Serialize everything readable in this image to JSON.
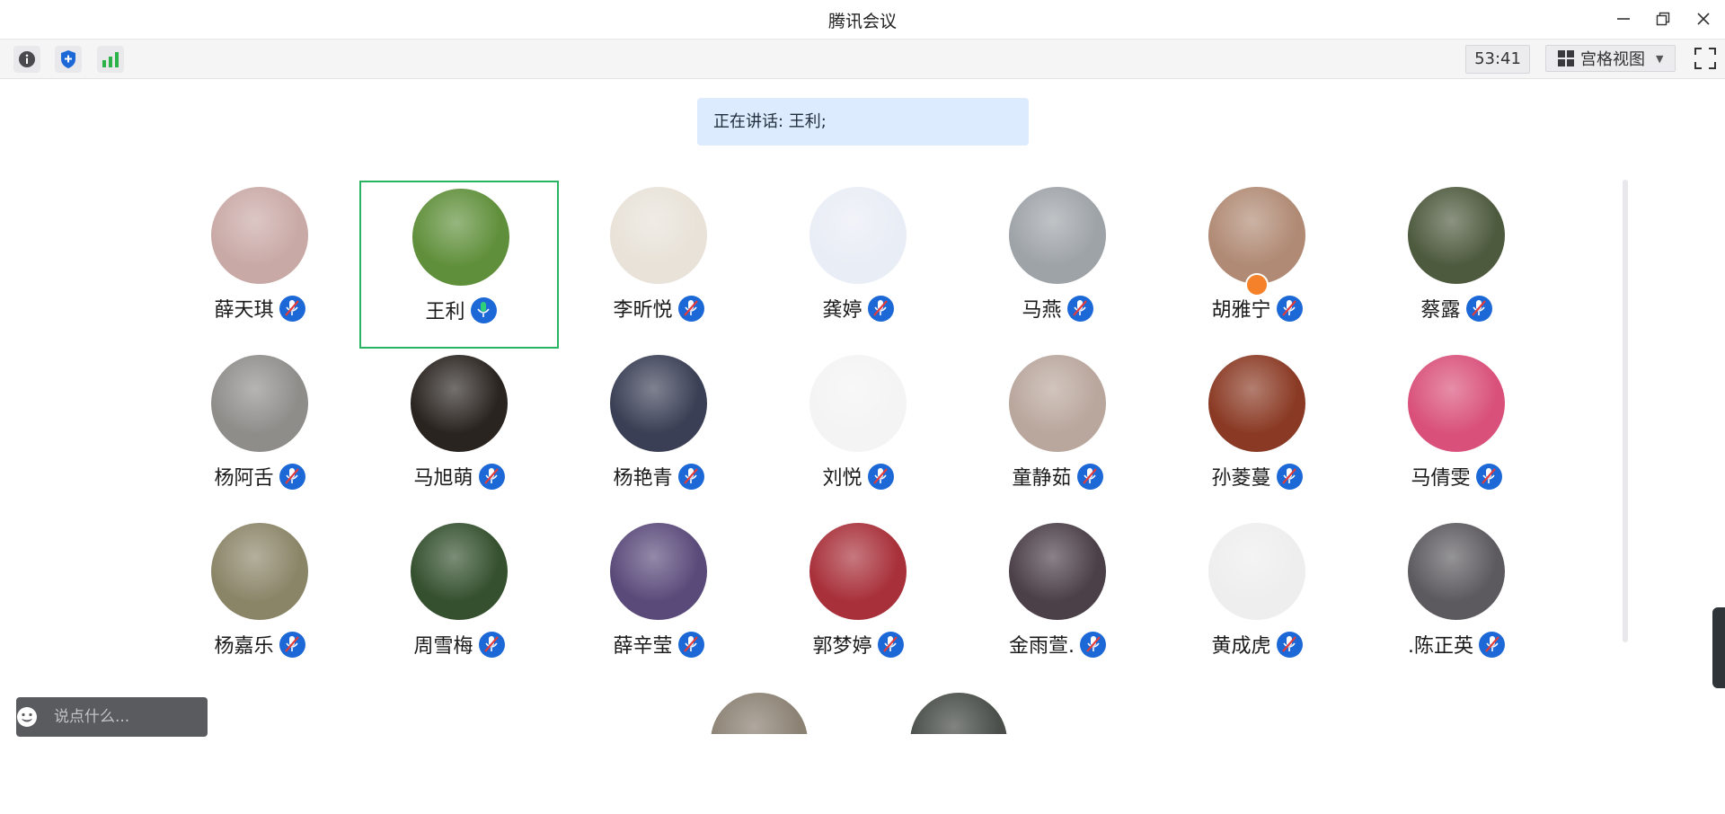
{
  "window": {
    "title": "腾讯会议"
  },
  "toolbar": {
    "timer": "53:41",
    "view_label": "宫格视图"
  },
  "banner": {
    "speaking_text": "正在讲话: 王利;"
  },
  "participants": [
    {
      "name": "薛天琪",
      "mic": "muted",
      "avatar_color": "#c9a9a6"
    },
    {
      "name": "王利",
      "mic": "speaking",
      "avatar_color": "#5f8f3a",
      "active": true
    },
    {
      "name": "李昕悦",
      "mic": "muted",
      "avatar_color": "#e8e2d8"
    },
    {
      "name": "龚婷",
      "mic": "muted",
      "avatar_color": "#e9edf5"
    },
    {
      "name": "马燕",
      "mic": "muted",
      "avatar_color": "#9ea3a8"
    },
    {
      "name": "胡雅宁",
      "mic": "muted",
      "avatar_color": "#b08a74",
      "host_badge": true
    },
    {
      "name": "蔡露",
      "mic": "muted",
      "avatar_color": "#4e5a3e"
    },
    {
      "name": "杨阿舌",
      "mic": "muted",
      "avatar_color": "#8e8d8a"
    },
    {
      "name": "马旭萌",
      "mic": "muted",
      "avatar_color": "#2a2420"
    },
    {
      "name": "杨艳青",
      "mic": "muted",
      "avatar_color": "#3a3f55"
    },
    {
      "name": "刘悦",
      "mic": "muted",
      "avatar_color": "#f4f4f4"
    },
    {
      "name": "童静茹",
      "mic": "muted",
      "avatar_color": "#b9a69c"
    },
    {
      "name": "孙菱蔓",
      "mic": "muted",
      "avatar_color": "#8a3a24"
    },
    {
      "name": "马倩雯",
      "mic": "muted",
      "avatar_color": "#d9517a"
    },
    {
      "name": "杨嘉乐",
      "mic": "muted",
      "avatar_color": "#8b8568"
    },
    {
      "name": "周雪梅",
      "mic": "muted",
      "avatar_color": "#34502e"
    },
    {
      "name": "薛辛莹",
      "mic": "muted",
      "avatar_color": "#5a4a7a"
    },
    {
      "name": "郭梦婷",
      "mic": "muted",
      "avatar_color": "#a8303a"
    },
    {
      "name": "金雨萱.",
      "mic": "muted",
      "avatar_color": "#4b3f48"
    },
    {
      "name": "黄成虎",
      "mic": "muted",
      "avatar_color": "#eeeeee"
    },
    {
      "name": ".陈正英",
      "mic": "muted",
      "avatar_color": "#5c5a5e"
    }
  ],
  "partial_avatars": [
    {
      "avatar_color": "#8c8274"
    },
    {
      "avatar_color": "#4a4f4a"
    }
  ],
  "chat": {
    "placeholder": "说点什么..."
  },
  "colors": {
    "accent": "#1b68d6",
    "active_border": "#28b463",
    "banner_bg": "#dcebfd"
  }
}
